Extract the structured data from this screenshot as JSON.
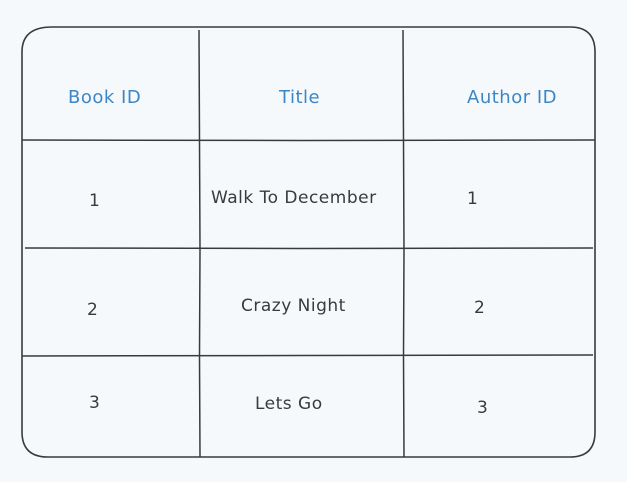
{
  "table": {
    "headers": [
      "Book ID",
      "Title",
      "Author ID"
    ],
    "rows": [
      [
        "1",
        "Walk To December",
        "1"
      ],
      [
        "2",
        "Crazy Night",
        "2"
      ],
      [
        "3",
        "Lets Go",
        "3"
      ]
    ]
  },
  "colors": {
    "header_text": "#3d86c6",
    "cell_text": "#3a3a3a",
    "stroke": "#3a3a3a",
    "background": "#f5f9fc"
  }
}
